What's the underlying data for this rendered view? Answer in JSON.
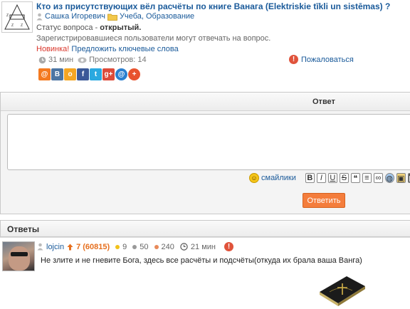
{
  "question": {
    "title": "Кто из присутствующих вёл расчёты по книге Ванага (Elektriskie tīkli un sistēmas) ?",
    "author": "Сашка Игоревич",
    "category": "Учеба, Образование",
    "status_prefix": "Статус вопроса - ",
    "status_value": "открытый.",
    "notice": "Зарегистрировавшиеся пользователи могут отвечать на вопрос.",
    "new_label": "Новинка!",
    "suggest_label": "Предложить ключевые слова",
    "time_ago": "31 мин",
    "views": "Просмотров: 14",
    "report_label": "Пожаловаться"
  },
  "share": [
    {
      "icon": "mail-ru-icon",
      "glyph": "@",
      "color": "#f47a20"
    },
    {
      "icon": "vk-icon",
      "glyph": "В",
      "color": "#4c75a3"
    },
    {
      "icon": "odnoklassniki-icon",
      "glyph": "о",
      "color": "#f5a623"
    },
    {
      "icon": "facebook-icon",
      "glyph": "f",
      "color": "#3b5998"
    },
    {
      "icon": "twitter-icon",
      "glyph": "t",
      "color": "#2aa9e0"
    },
    {
      "icon": "google-plus-icon",
      "glyph": "g+",
      "color": "#dd4b39"
    },
    {
      "icon": "email-icon",
      "glyph": "@",
      "color": "#2a7fd0"
    },
    {
      "icon": "more-share-icon",
      "glyph": "+",
      "color": "#e8532e"
    }
  ],
  "answer_form": {
    "header": "Ответ",
    "smiles_label": "смайлики",
    "submit_label": "Ответить",
    "toolbar": [
      "B",
      "I",
      "U",
      "S"
    ]
  },
  "answers": {
    "header": "Ответы",
    "items": [
      {
        "user": "lojcin",
        "rating": "7 (60815)",
        "yellow_count": "9",
        "gray_count": "50",
        "orange_count": "240",
        "time_ago": "21 мин",
        "text": "Не злите и не гневите Бога, здесь все расчёты и подсчёты(откуда их брала ваша Ванга)"
      }
    ]
  },
  "colors": {
    "link": "#1a5a9a",
    "accent_orange": "#f47d3c",
    "new_red": "#d9362b"
  }
}
